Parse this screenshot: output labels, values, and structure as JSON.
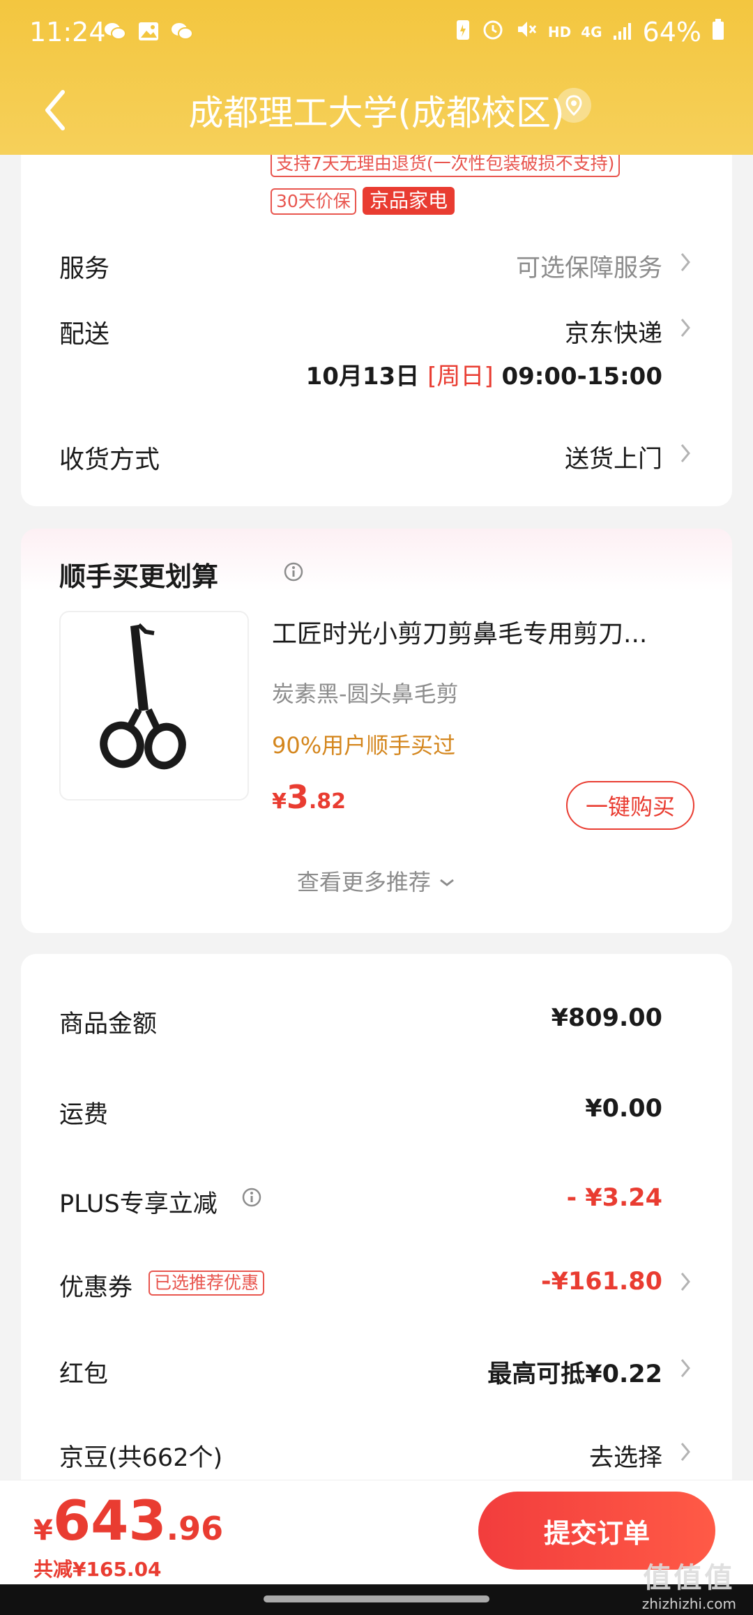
{
  "status_bar": {
    "time": "11:24",
    "battery": "64%",
    "network": "4G",
    "hd": "HD"
  },
  "nav": {
    "title": "成都理工大学(成都校区)"
  },
  "service_tags": {
    "return_policy": "支持7天无理由退货(一次性包装破损不支持)",
    "price_protect": "30天价保",
    "category": "京品家电"
  },
  "rows": {
    "service": {
      "label": "服务",
      "value": "可选保障服务"
    },
    "delivery": {
      "label": "配送",
      "value": "京东快递",
      "date": "10月13日",
      "weekday": "[周日]",
      "time": "09:00-15:00"
    },
    "receive": {
      "label": "收货方式",
      "value": "送货上门"
    }
  },
  "recommend": {
    "title": "顺手买更划算",
    "product": {
      "name": "工匠时光小剪刀剪鼻毛专用剪刀...",
      "spec": "炭素黑-圆头鼻毛剪",
      "badge": "90%用户顺手买过",
      "price_symbol": "¥",
      "price_int": "3",
      "price_dec": ".82",
      "buy_label": "一键购买"
    },
    "more_label": "查看更多推荐"
  },
  "fees": {
    "goods": {
      "label": "商品金额",
      "value": "¥809.00"
    },
    "shipping": {
      "label": "运费",
      "value": "¥0.00"
    },
    "plus": {
      "label": "PLUS专享立减",
      "value": "- ¥3.24"
    },
    "coupon": {
      "label": "优惠券",
      "tag": "已选推荐优惠",
      "value": "-¥161.80"
    },
    "redpacket": {
      "label": "红包",
      "value": "最高可抵¥0.22"
    },
    "jingdou": {
      "label": "京豆(共662个)",
      "value": "去选择"
    }
  },
  "bottom": {
    "price_symbol": "¥",
    "price_int": "643",
    "price_dec": ".96",
    "reduce": "共减¥165.04",
    "submit_label": "提交订单"
  },
  "watermark": {
    "big": "值值值",
    "small": "zhizhizhi.com"
  },
  "colors": {
    "header": "#f3c63f",
    "accent_red": "#e93c31",
    "badge_orange": "#d4861d"
  }
}
